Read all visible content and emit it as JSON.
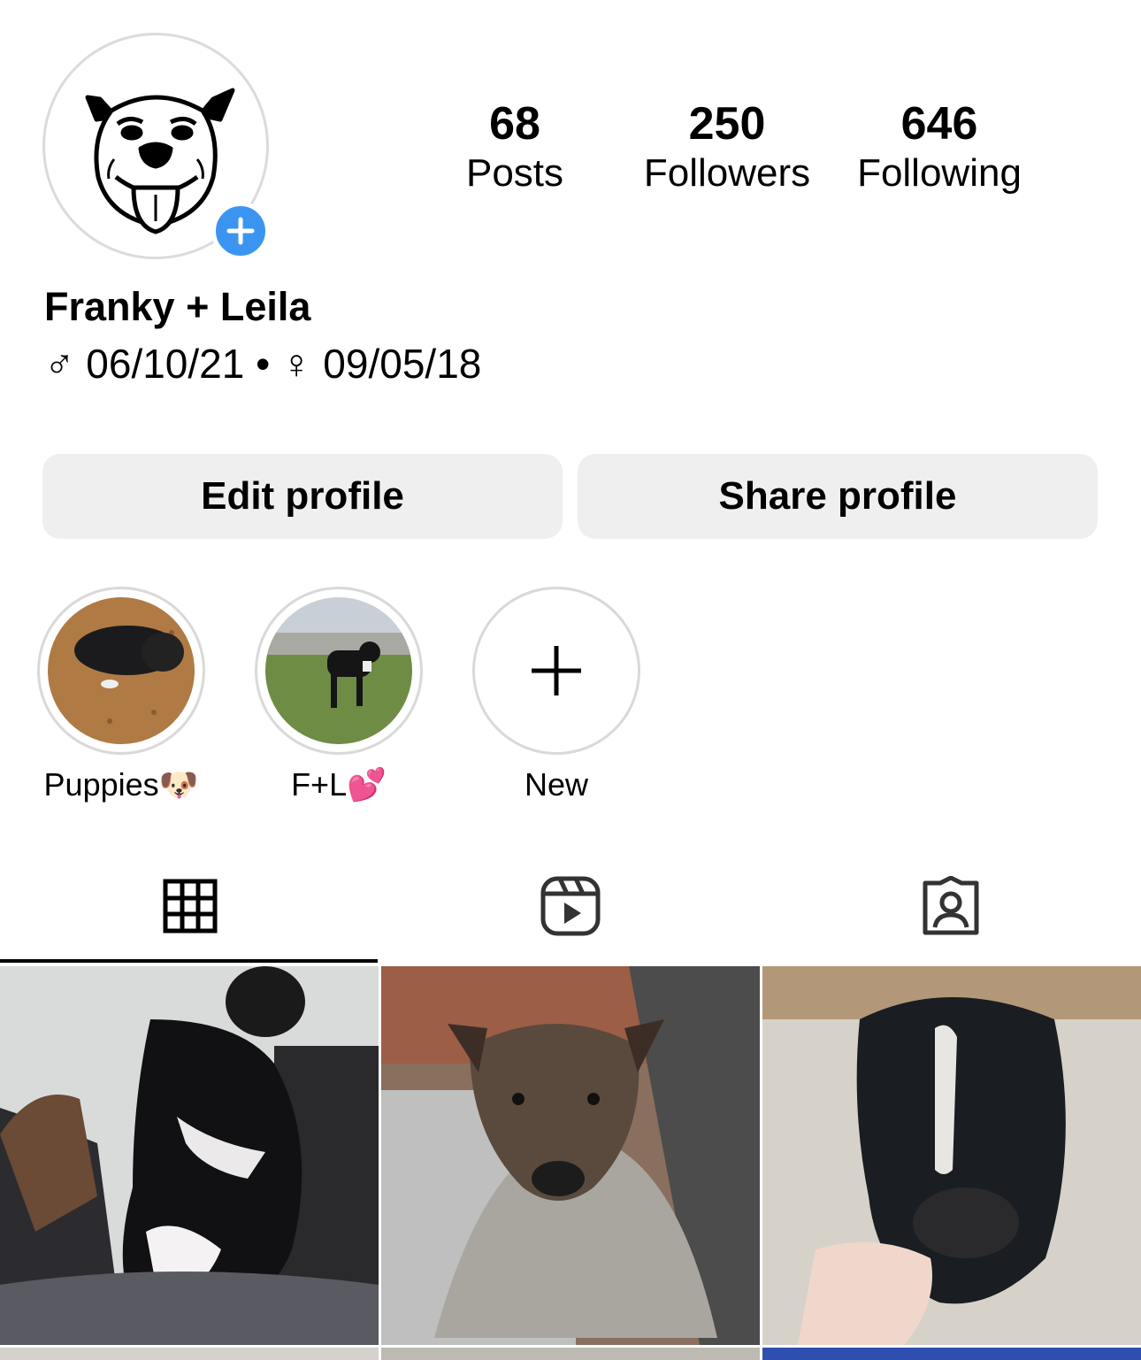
{
  "profile": {
    "name": "Franky + Leila",
    "bio": {
      "male_symbol": "♂",
      "male_date": "06/10/21",
      "separator": "•",
      "female_symbol": "♀",
      "female_date": "09/05/18"
    },
    "avatar_icon": "dog-logo-icon",
    "badge_icon": "plus-icon",
    "badge_color": "#3b95f0"
  },
  "stats": [
    {
      "value": "68",
      "label": "Posts"
    },
    {
      "value": "250",
      "label": "Followers"
    },
    {
      "value": "646",
      "label": "Following"
    }
  ],
  "buttons": {
    "edit": "Edit profile",
    "share": "Share profile"
  },
  "highlights": [
    {
      "label": "Puppies🐶"
    },
    {
      "label": "F+L💕"
    },
    {
      "label": "New"
    }
  ],
  "tabs": [
    {
      "icon": "grid-icon",
      "selected": true
    },
    {
      "icon": "reels-icon",
      "selected": false
    },
    {
      "icon": "tagged-icon",
      "selected": false
    }
  ]
}
